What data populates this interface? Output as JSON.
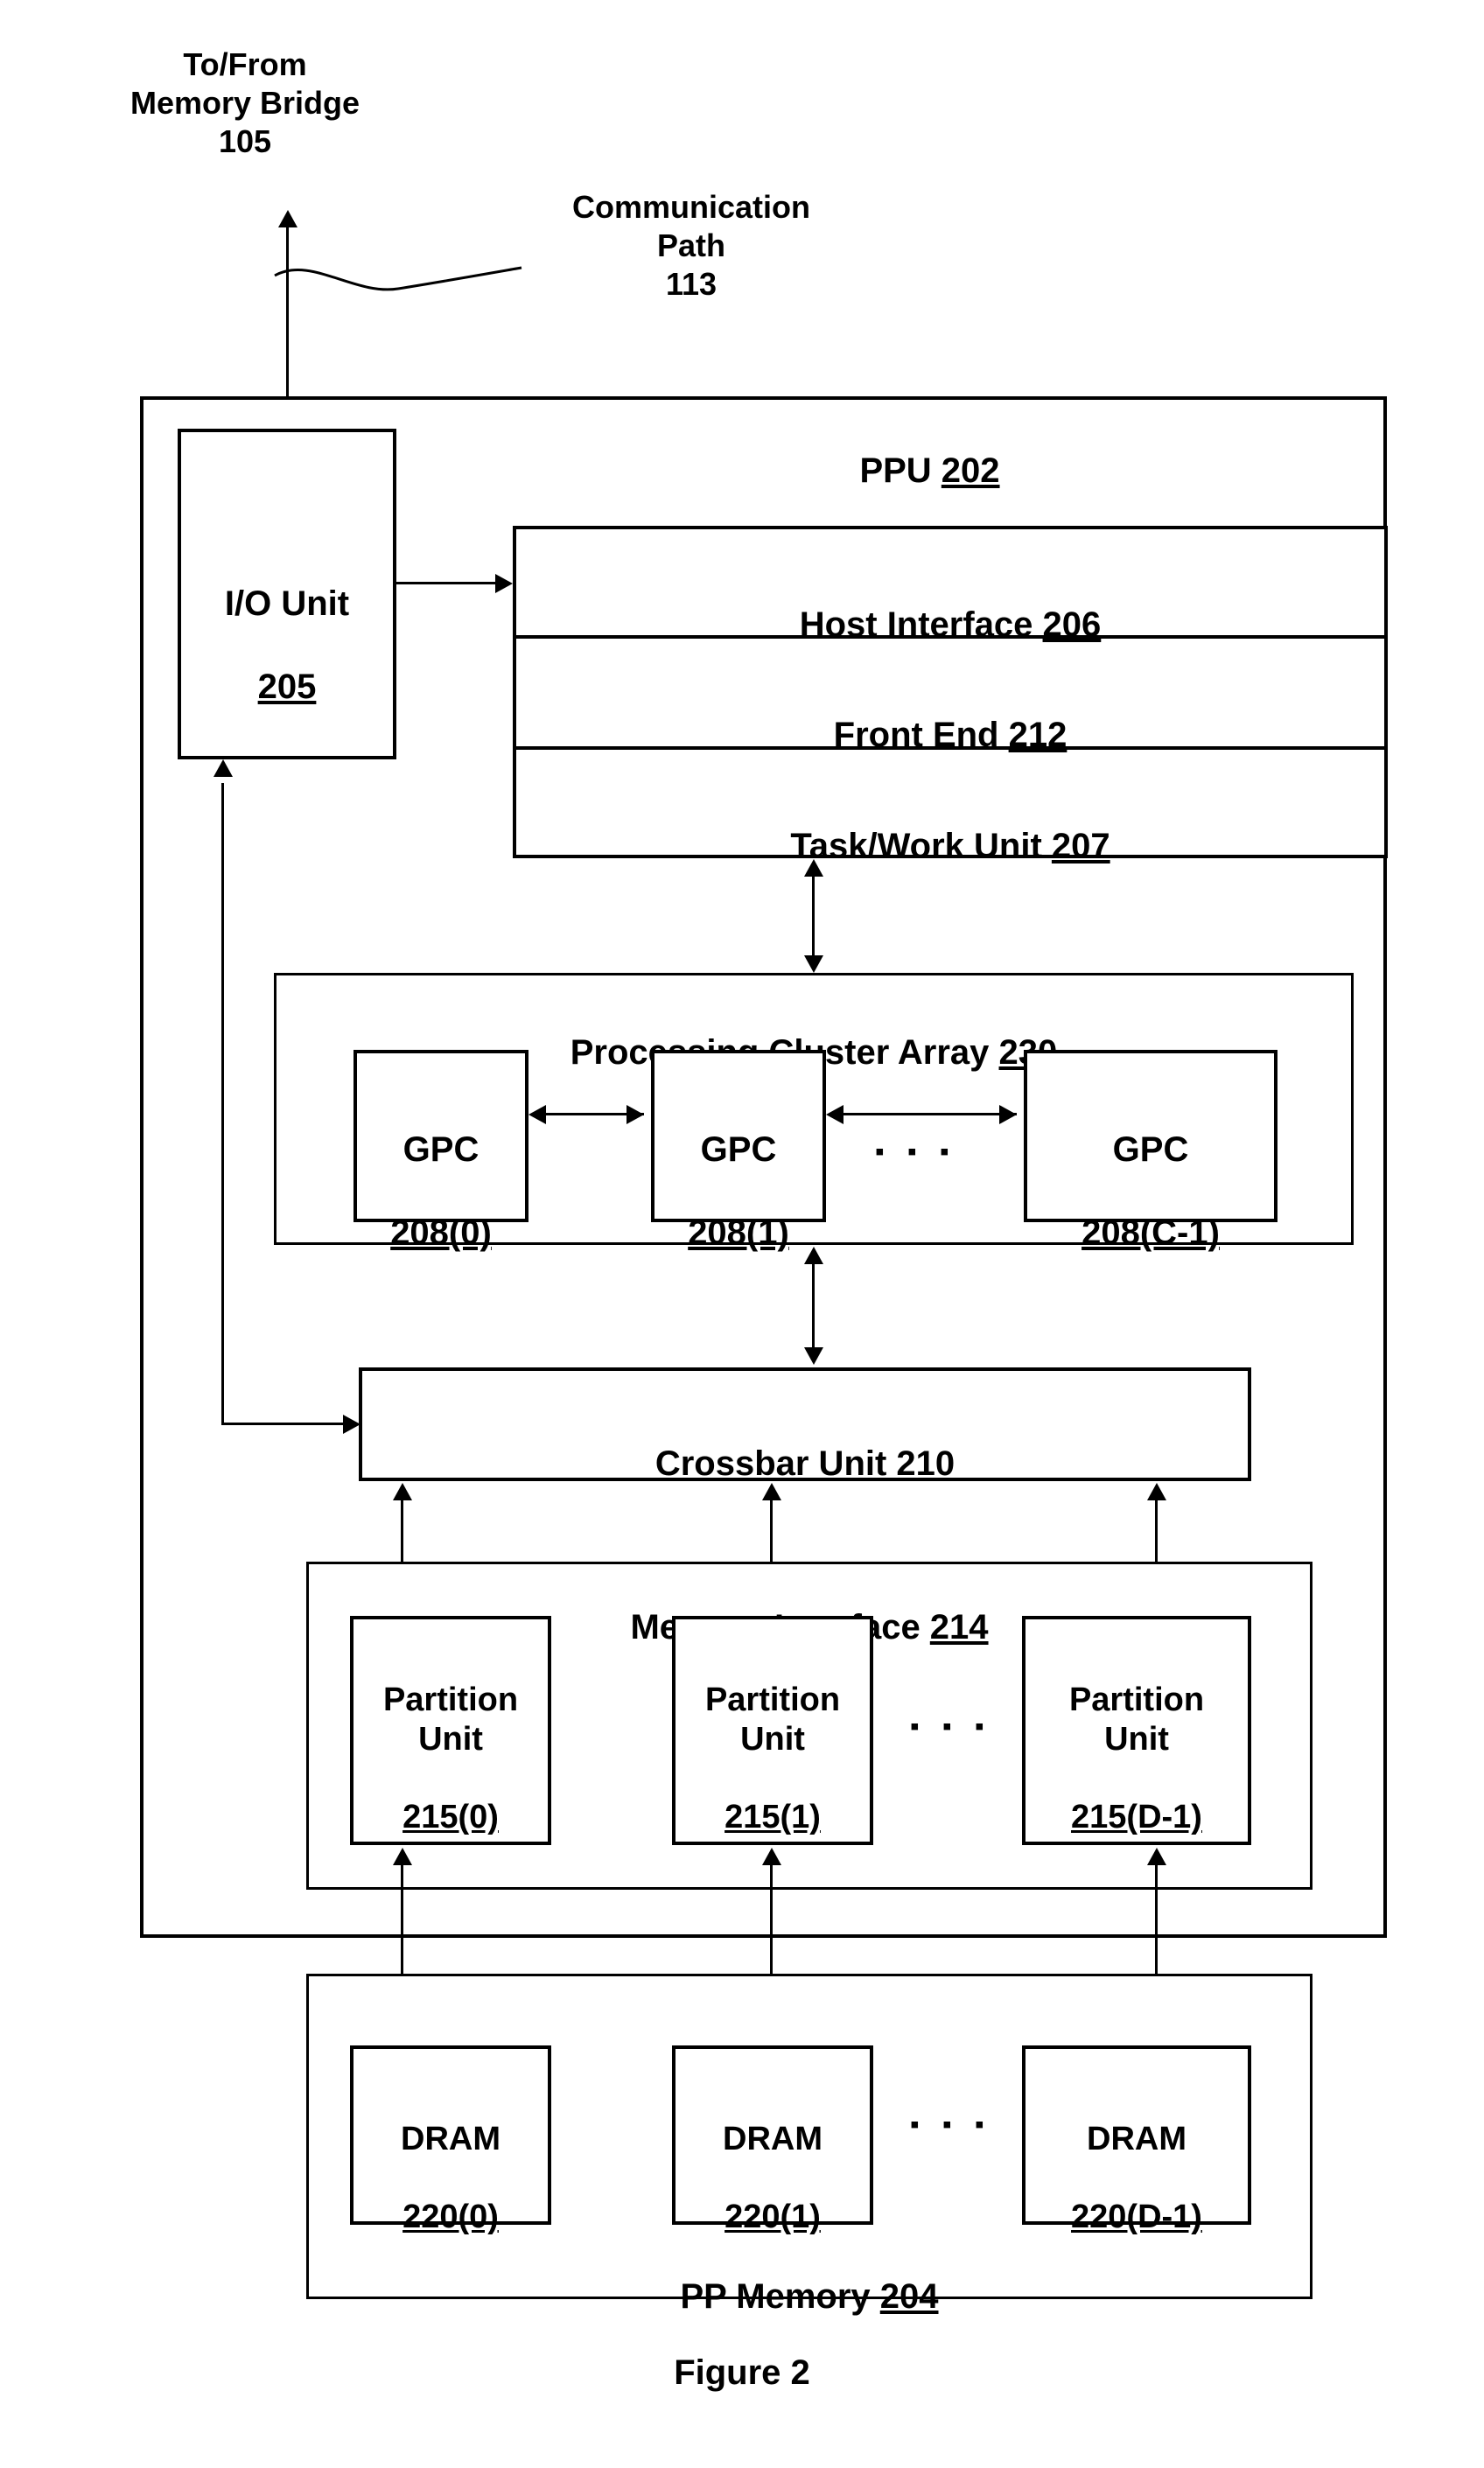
{
  "figure": {
    "caption": "Figure 2"
  },
  "external_labels": {
    "memory_bridge": "To/From\nMemory Bridge\n105",
    "communication_path": "Communication\nPath\n113"
  },
  "ppu": {
    "title_text": "PPU ",
    "title_ref": "202",
    "io_unit": {
      "label": "I/O Unit",
      "ref": "205"
    },
    "host_interface": {
      "label": "Host Interface ",
      "ref": "206"
    },
    "front_end": {
      "label": "Front End ",
      "ref": "212"
    },
    "task_work_unit": {
      "label": "Task/Work Unit ",
      "ref": "207"
    },
    "processing_cluster_array": {
      "label": "Processing Cluster Array ",
      "ref": "230",
      "ellipsis": "▪ ▪ ▪",
      "gpcs": [
        {
          "label": "GPC",
          "ref": "208(0)"
        },
        {
          "label": "GPC",
          "ref": "208(1)"
        },
        {
          "label": "GPC",
          "ref": "208(C-1)"
        }
      ]
    },
    "crossbar_unit": {
      "label": "Crossbar Unit ",
      "ref": "210"
    },
    "memory_interface": {
      "label": "Memory Interface ",
      "ref": "214",
      "ellipsis": "▪ ▪ ▪",
      "partition_units": [
        {
          "label": "Partition\nUnit",
          "ref": "215(0)"
        },
        {
          "label": "Partition\nUnit",
          "ref": "215(1)"
        },
        {
          "label": "Partition\nUnit",
          "ref": "215(D-1)"
        }
      ]
    }
  },
  "pp_memory": {
    "label": "PP Memory ",
    "ref": "204",
    "ellipsis": "▪ ▪ ▪",
    "drams": [
      {
        "label": "DRAM",
        "ref": "220(0)"
      },
      {
        "label": "DRAM",
        "ref": "220(1)"
      },
      {
        "label": "DRAM",
        "ref": "220(D-1)"
      }
    ]
  }
}
